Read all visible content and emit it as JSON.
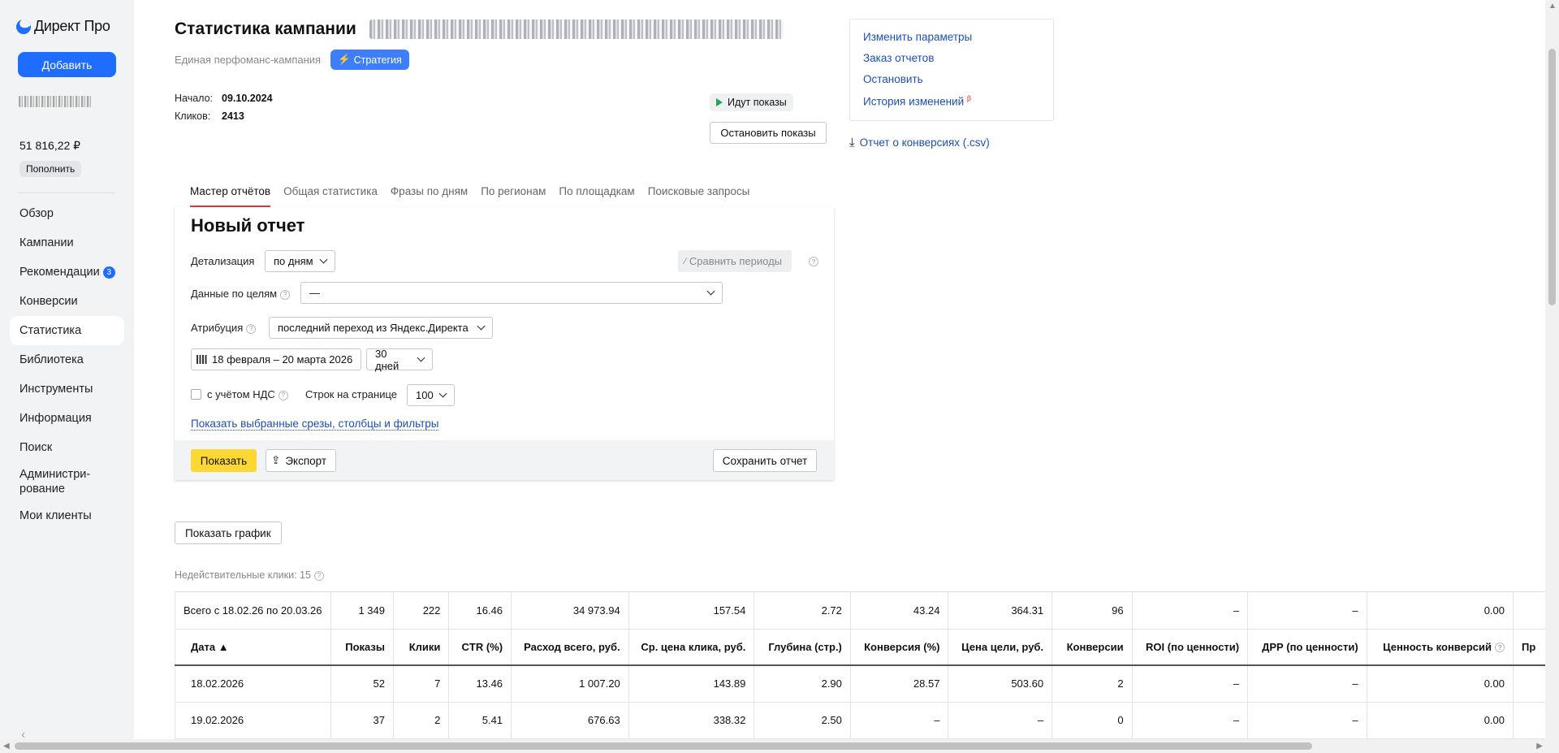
{
  "brand": {
    "name": "Директ Про"
  },
  "sidebar": {
    "add_label": "Добавить",
    "balance": "51 816,22 ₽",
    "topup_label": "Пополнить",
    "items": [
      {
        "label": "Обзор"
      },
      {
        "label": "Кампании"
      },
      {
        "label": "Рекомендации",
        "badge": "3"
      },
      {
        "label": "Конверсии"
      },
      {
        "label": "Статистика",
        "active": true
      },
      {
        "label": "Библиотека"
      },
      {
        "label": "Инструменты"
      },
      {
        "label": "Информация"
      },
      {
        "label": "Поиск"
      },
      {
        "label": "Администри-\nрование"
      },
      {
        "label": "Мои клиенты"
      }
    ]
  },
  "header": {
    "title": "Статистика кампании",
    "subtitle": "Единая перфоманс-кампания",
    "strategy_label": "Стратегия",
    "start_label": "Начало:",
    "start_value": "09.10.2024",
    "clicks_label": "Кликов:",
    "clicks_value": "2413",
    "status": "Идут показы",
    "stop_label": "Остановить показы"
  },
  "actions": {
    "edit": "Изменить параметры",
    "order_reports": "Заказ отчетов",
    "stop": "Остановить",
    "history": "История изменений",
    "history_badge": "β",
    "csv": "Отчет о конверсиях (.csv)"
  },
  "tabs": [
    {
      "label": "Мастер отчётов",
      "active": true
    },
    {
      "label": "Общая статистика"
    },
    {
      "label": "Фразы по дням"
    },
    {
      "label": "По регионам"
    },
    {
      "label": "По площадкам"
    },
    {
      "label": "Поисковые запросы"
    }
  ],
  "report": {
    "title": "Новый отчет",
    "detail_label": "Детализация",
    "detail_value": "по дням",
    "compare_label": "Сравнить периоды",
    "goals_label": "Данные по целям",
    "goals_value": "—",
    "attribution_label": "Атрибуция",
    "attribution_value": "последний переход из Яндекс.Директа",
    "date_range": "18 февраля – 20 марта 2026",
    "period": "30 дней",
    "vat_label": "с учётом НДС",
    "rows_label": "Строк на странице",
    "rows_value": "100",
    "show_filters_link": "Показать выбранные срезы, столбцы и фильтры",
    "show_btn": "Показать",
    "export_btn": "Экспорт",
    "save_btn": "Сохранить отчет"
  },
  "show_chart_label": "Показать график",
  "invalid_clicks": "Недействительные клики: 15",
  "table": {
    "total_label": "Всего с 18.02.26 по 20.03.26",
    "total": [
      "1 349",
      "222",
      "16.46",
      "34 973.94",
      "157.54",
      "2.72",
      "43.24",
      "364.31",
      "96",
      "–",
      "–",
      "0.00"
    ],
    "headers": [
      "Дата ▲",
      "Показы",
      "Клики",
      "CTR (%)",
      "Расход всего, руб.",
      "Ср. цена клика, руб.",
      "Глубина (стр.)",
      "Конверсия (%)",
      "Цена цели, руб.",
      "Конверсии",
      "ROI (по ценности)",
      "ДРР (по ценности)",
      "Ценность конверсий",
      "Пр"
    ],
    "rows": [
      [
        "18.02.2026",
        "52",
        "7",
        "13.46",
        "1 007.20",
        "143.89",
        "2.90",
        "28.57",
        "503.60",
        "2",
        "–",
        "–",
        "0.00"
      ],
      [
        "19.02.2026",
        "37",
        "2",
        "5.41",
        "676.63",
        "338.32",
        "2.50",
        "–",
        "–",
        "0",
        "–",
        "–",
        "0.00"
      ]
    ]
  }
}
